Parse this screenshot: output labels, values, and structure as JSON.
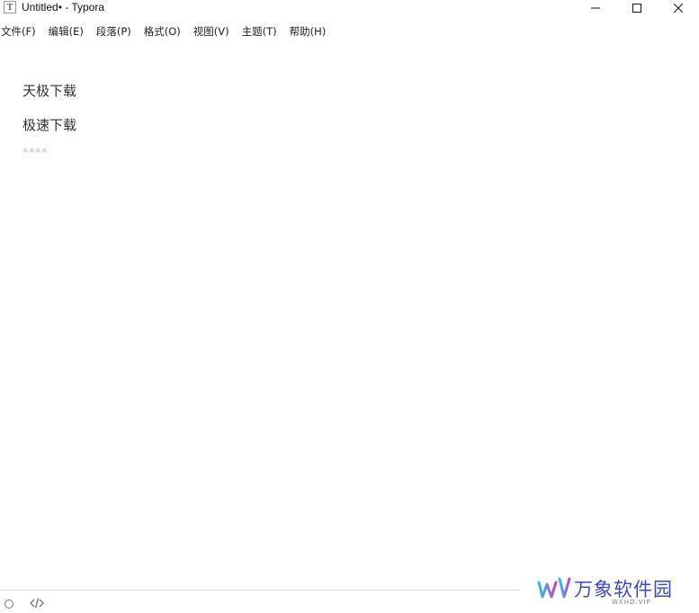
{
  "window": {
    "title": "Untitled• - Typora",
    "app_icon_glyph": "T",
    "controls": [
      "minimize-icon",
      "maximize-icon",
      "close-icon"
    ]
  },
  "menu": {
    "items": [
      {
        "label": "文件(F)"
      },
      {
        "label": "编辑(E)"
      },
      {
        "label": "段落(P)"
      },
      {
        "label": "格式(O)"
      },
      {
        "label": "视图(V)"
      },
      {
        "label": "主题(T)"
      },
      {
        "label": "帮助(H)"
      }
    ]
  },
  "editor": {
    "paragraphs": [
      {
        "text": "天极下载"
      },
      {
        "text": "极速下载"
      },
      {
        "text": "****"
      }
    ]
  },
  "statusbar": {
    "icons": [
      "circle-status-icon",
      "source-code-icon"
    ]
  },
  "watermark": {
    "brand": "万象软件园",
    "domain": "WXHD.VIP"
  },
  "colors": {
    "text": "#333333",
    "placeholder": "#c4c4c4",
    "watermark": "#3d47c8"
  }
}
